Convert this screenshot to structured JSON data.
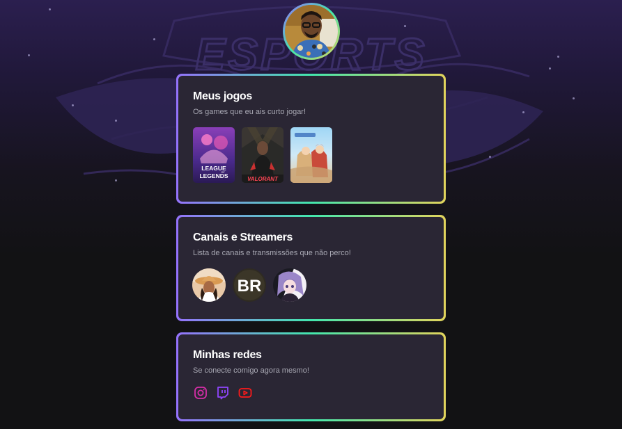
{
  "background": {
    "watermark_text": "ESPORTS"
  },
  "profile": {
    "avatar_alt": "profile-photo"
  },
  "cards": {
    "games": {
      "title": "Meus jogos",
      "subtitle": "Os games que eu ais curto jogar!",
      "items": [
        {
          "name": "League of Legends",
          "logo_line1": "LEAGUE",
          "logo_line2": "LEGENDS",
          "logo_small": "OF"
        },
        {
          "name": "Valorant",
          "logo": "VALORANT"
        },
        {
          "name": "Anime RPG",
          "logo": ""
        }
      ]
    },
    "channels": {
      "title": "Canais e Streamers",
      "subtitle": "Lista de canais e transmissões que não perco!",
      "items": [
        {
          "name": "streamer-1"
        },
        {
          "name": "streamer-2",
          "text": "BR"
        },
        {
          "name": "streamer-3"
        }
      ]
    },
    "socials": {
      "title": "Minhas redes",
      "subtitle": "Se conecte comigo agora mesmo!",
      "items": [
        {
          "name": "instagram",
          "icon": "instagram-icon",
          "color": "#d62ea8"
        },
        {
          "name": "twitch",
          "icon": "twitch-icon",
          "color": "#9146ff"
        },
        {
          "name": "youtube",
          "icon": "youtube-icon",
          "color": "#ff1a1a"
        }
      ]
    }
  },
  "colors": {
    "gradient_start": "#9572fc",
    "gradient_mid": "#43e7ad",
    "gradient_end": "#e2d45c",
    "card_bg": "#2a2634",
    "title": "#ffffff",
    "subtitle": "#a8a8b3"
  }
}
